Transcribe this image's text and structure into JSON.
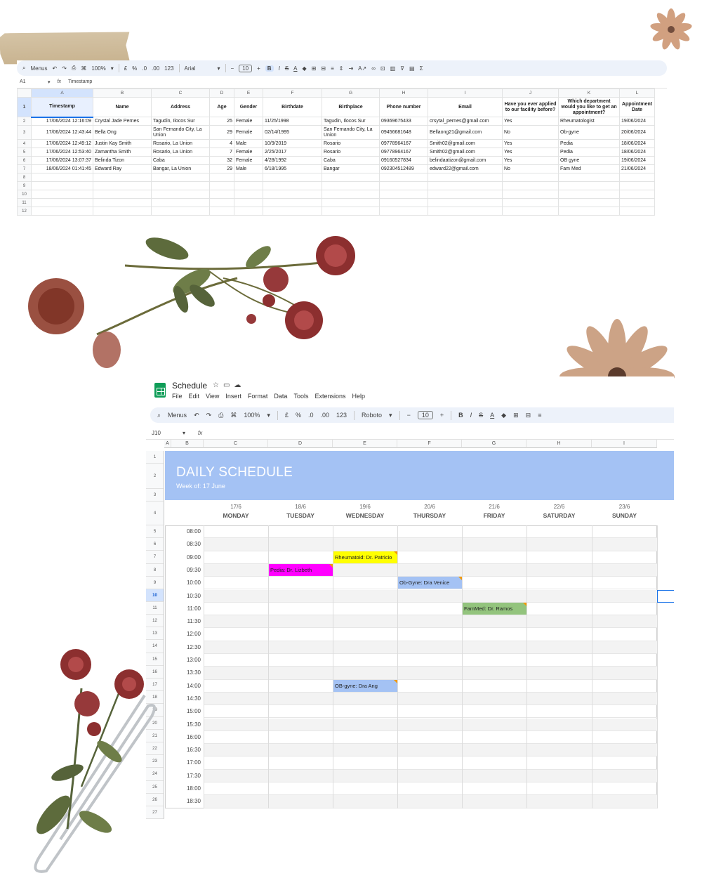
{
  "sheet1": {
    "toolbar": {
      "menus": "Menus",
      "zoom": "100%",
      "currency": "£",
      "percent": "%",
      "dec_less": ".0",
      "dec_more": ".00",
      "num_format": "123",
      "font": "Arial",
      "font_size": "10"
    },
    "formula_bar": {
      "cell": "A1",
      "fx": "fx",
      "value": "Timestamp"
    },
    "columns": [
      "A",
      "B",
      "C",
      "D",
      "E",
      "F",
      "G",
      "H",
      "I",
      "J",
      "K",
      "L"
    ],
    "headers": [
      "Timestamp",
      "Name",
      "Address",
      "Age",
      "Gender",
      "Birthdate",
      "Birthplace",
      "Phone number",
      "Email",
      "Have you ever applied to our facility before?",
      "Which department would you like to get an appointment?",
      "Appointment Date"
    ],
    "rows": [
      [
        "17/06/2024 12:16:09",
        "Crystal Jade Pernes",
        "Tagudin, Ilocos Sur",
        "25",
        "Female",
        "11/25/1998",
        "Tagudin, Ilocos Sur",
        "09369675433",
        "crsytal_pernes@gmail.com",
        "Yes",
        "Rheumatologist",
        "19/06/2024"
      ],
      [
        "17/06/2024 12:43:44",
        "Bella Ong",
        "San Fernando City, La Union",
        "29",
        "Female",
        "02/14/1995",
        "San Fernando City, La Union",
        "09456681648",
        "Bellaong21@gmail.com",
        "No",
        "Ob-gyne",
        "20/06/2024"
      ],
      [
        "17/06/2024 12:49:12",
        "Justin Kay Smith",
        "Rosario, La Union",
        "4",
        "Male",
        "10/9/2019",
        "Rosario",
        "09778964167",
        "Smith02@gmail.com",
        "Yes",
        "Pedia",
        "18/06/2024"
      ],
      [
        "17/06/2024 12:53:40",
        "Zamantha Smith",
        "Rosario, La Union",
        "7",
        "Female",
        "2/25/2017",
        "Rosario",
        "09778964167",
        "Smith02@gmail.com",
        "Yes",
        "Pedia",
        "18/06/2024"
      ],
      [
        "17/06/2024 13:07:37",
        "Belinda Tizon",
        "Caba",
        "32",
        "Female",
        "4/28/1992",
        "Caba",
        "09160527834",
        "belindaatizon@gmail.com",
        "Yes",
        "OB gyne",
        "19/06/2024"
      ],
      [
        "18/06/2024 01:41:45",
        "Edward Ray",
        "Bangar, La Union",
        "29",
        "Male",
        "6/18/1995",
        "Bangar",
        "092304512489",
        "edward22@gmail.com",
        "No",
        "Fam Med",
        "21/06/2024"
      ]
    ],
    "row_numbers": [
      "1",
      "2",
      "3",
      "4",
      "5",
      "6",
      "7",
      "8",
      "9",
      "10",
      "11",
      "12"
    ]
  },
  "sheet2": {
    "title": "Schedule",
    "menu": [
      "File",
      "Edit",
      "View",
      "Insert",
      "Format",
      "Data",
      "Tools",
      "Extensions",
      "Help"
    ],
    "toolbar": {
      "menus": "Menus",
      "zoom": "100%",
      "currency": "£",
      "percent": "%",
      "dec_less": ".0",
      "dec_more": ".00",
      "num_format": "123",
      "font": "Roboto",
      "font_size": "10"
    },
    "formula_bar": {
      "cell": "J10",
      "fx": "fx",
      "value": ""
    },
    "columns": [
      "A",
      "B",
      "C",
      "D",
      "E",
      "F",
      "G",
      "H",
      "I"
    ],
    "banner_title": "DAILY SCHEDULE",
    "banner_subtitle": "Week of: 17 June",
    "days": [
      {
        "date": "17/6",
        "name": "MONDAY"
      },
      {
        "date": "18/6",
        "name": "TUESDAY"
      },
      {
        "date": "19/6",
        "name": "WEDNESDAY"
      },
      {
        "date": "20/6",
        "name": "THURSDAY"
      },
      {
        "date": "21/6",
        "name": "FRIDAY"
      },
      {
        "date": "22/6",
        "name": "SATURDAY"
      },
      {
        "date": "23/6",
        "name": "SUNDAY"
      }
    ],
    "times": [
      "08:00",
      "08:30",
      "09:00",
      "09:30",
      "10:00",
      "10:30",
      "11:00",
      "11:30",
      "12:00",
      "12:30",
      "13:00",
      "13:30",
      "14:00",
      "14:30",
      "15:00",
      "15:30",
      "16:00",
      "16:30",
      "17:00",
      "17:30",
      "18:00",
      "18:30"
    ],
    "appointments": [
      {
        "label": "Rheumatoid: Dr. Patricio",
        "day": 2,
        "slot": 2,
        "color": "#ffff00"
      },
      {
        "label": "Pedia: Dr. Lizbeth",
        "day": 1,
        "slot": 3,
        "color": "#ff00ff"
      },
      {
        "label": "Ob-Gyne: Dra Venice",
        "day": 3,
        "slot": 4,
        "color": "#a4c2f4"
      },
      {
        "label": "FamMed: Dr. Ramos",
        "day": 4,
        "slot": 6,
        "color": "#93c47d"
      },
      {
        "label": "OB-gyne: Dra Ang",
        "day": 2,
        "slot": 12,
        "color": "#a4c2f4"
      }
    ],
    "row_numbers": [
      "1",
      "2",
      "3",
      "4",
      "5",
      "6",
      "7",
      "8",
      "9",
      "10",
      "11",
      "12",
      "13",
      "14",
      "15",
      "16",
      "17",
      "18",
      "19",
      "20",
      "21",
      "22",
      "23",
      "24",
      "25",
      "26",
      "27"
    ],
    "selected_row": "10"
  }
}
